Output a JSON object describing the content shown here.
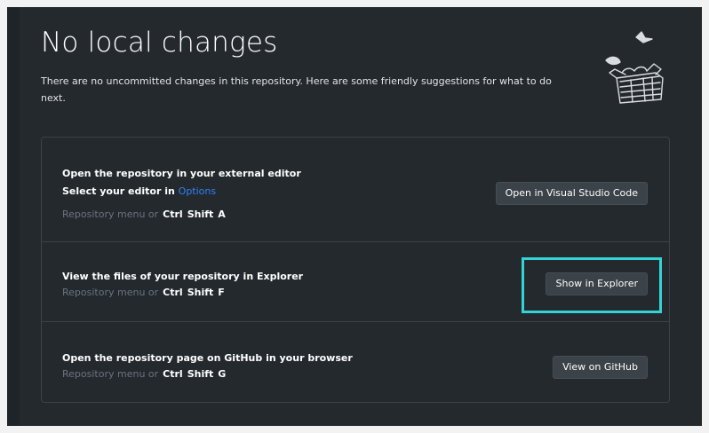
{
  "blank_slate": {
    "title": "No local changes",
    "description": "There are no uncommitted changes in this repository. Here are some friendly suggestions for what to do next."
  },
  "actions": [
    {
      "title": "Open the repository in your external editor",
      "sub_prefix": "Select your editor in ",
      "sub_link": "Options",
      "shortcut_prefix": "Repository menu or",
      "keys": [
        "Ctrl",
        "Shift",
        "A"
      ],
      "button": "Open in Visual Studio Code"
    },
    {
      "title": "View the files of your repository in Explorer",
      "shortcut_prefix": "Repository menu or",
      "keys": [
        "Ctrl",
        "Shift",
        "F"
      ],
      "button": "Show in Explorer"
    },
    {
      "title": "Open the repository page on GitHub in your browser",
      "shortcut_prefix": "Repository menu or",
      "keys": [
        "Ctrl",
        "Shift",
        "G"
      ],
      "button": "View on GitHub"
    }
  ],
  "colors": {
    "background": "#24292e",
    "link": "#2f81f7",
    "focus_ring": "#33d3d6",
    "muted_text": "#6a737d"
  }
}
